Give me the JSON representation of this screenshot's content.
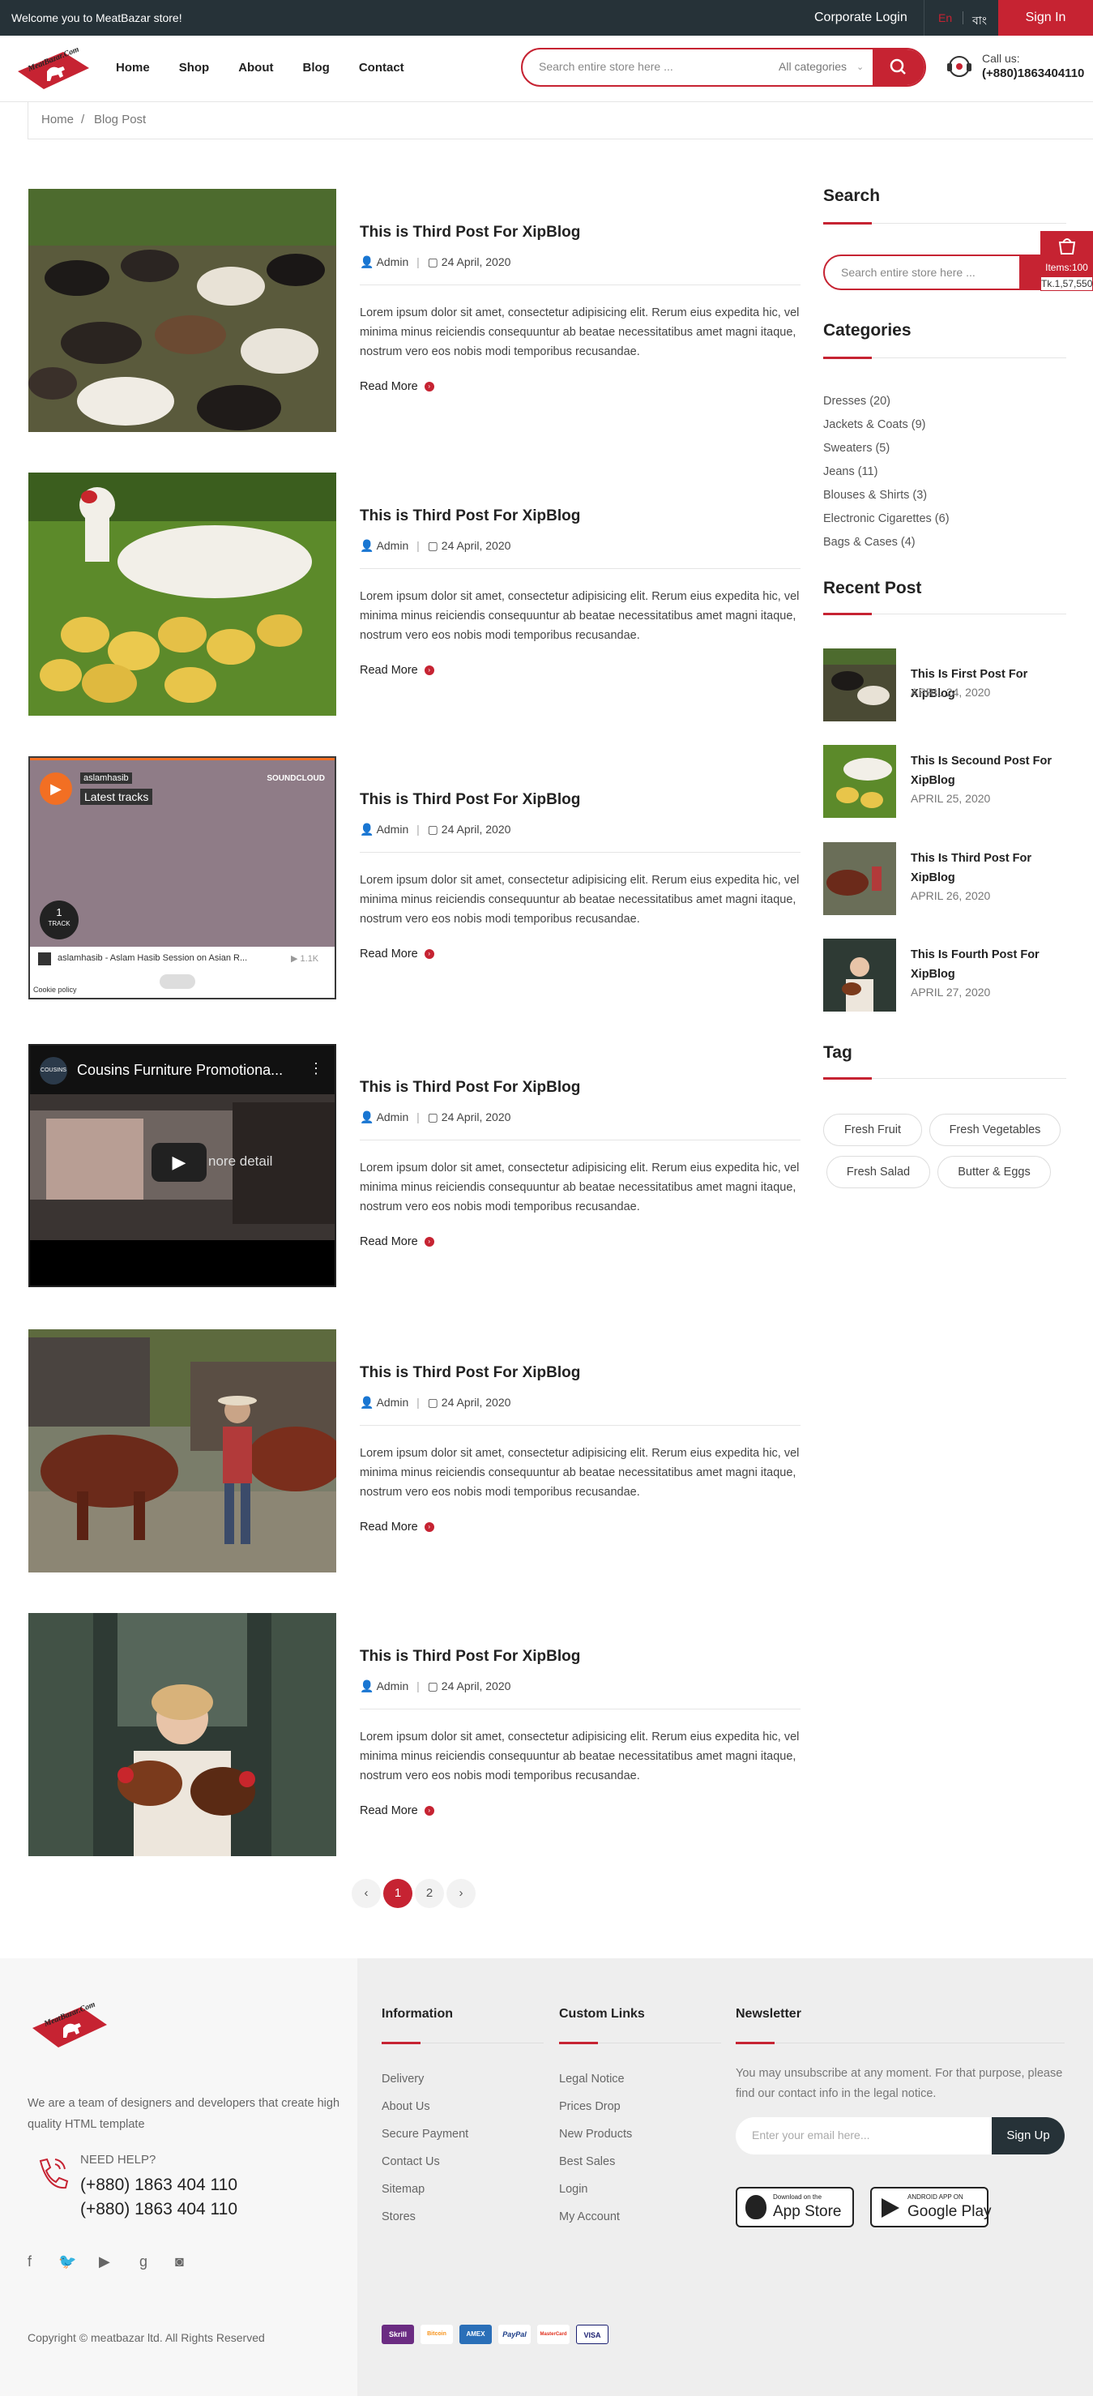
{
  "topbar": {
    "welcome": "Welcome you to MeatBazar store!",
    "corporate_login": "Corporate Login",
    "lang_en": "En",
    "lang_bn": "বাং",
    "sign_in": "Sign In"
  },
  "header": {
    "logo_text": "MeatBazar.Com",
    "nav": [
      "Home",
      "Shop",
      "About",
      "Blog",
      "Contact"
    ],
    "search_placeholder": "Search entire store here ...",
    "category_selected": "All categories",
    "call_label": "Call us:",
    "call_number": "(+880)1863404110"
  },
  "breadcrumb": {
    "home": "Home",
    "sep": "/",
    "current": "Blog Post"
  },
  "posts": [
    {
      "title": "This is Third Post For XipBlog",
      "author": "Admin",
      "date": "24 April, 2020",
      "excerpt": "Lorem ipsum dolor sit amet, consectetur adipisicing elit. Rerum eius expedita hic, vel minima minus reiciendis consequuntur ab beatae necessitatibus amet magni itaque, nostrum vero eos nobis modi temporibus recusandae.",
      "read_more": "Read More",
      "media": "goats-photo"
    },
    {
      "title": "This is Third Post For XipBlog",
      "author": "Admin",
      "date": "24 April, 2020",
      "excerpt": "Lorem ipsum dolor sit amet, consectetur adipisicing elit. Rerum eius expedita hic, vel minima minus reiciendis consequuntur ab beatae necessitatibus amet magni itaque, nostrum vero eos nobis modi temporibus recusandae.",
      "read_more": "Read More",
      "media": "ducks-photo"
    },
    {
      "title": "This is Third Post For XipBlog",
      "author": "Admin",
      "date": "24 April, 2020",
      "excerpt": "Lorem ipsum dolor sit amet, consectetur adipisicing elit. Rerum eius expedita hic, vel minima minus reiciendis consequuntur ab beatae necessitatibus amet magni itaque, nostrum vero eos nobis modi temporibus recusandae.",
      "read_more": "Read More",
      "media": "soundcloud-embed"
    },
    {
      "title": "This is Third Post For XipBlog",
      "author": "Admin",
      "date": "24 April, 2020",
      "excerpt": "Lorem ipsum dolor sit amet, consectetur adipisicing elit. Rerum eius expedita hic, vel minima minus reiciendis consequuntur ab beatae necessitatibus amet magni itaque, nostrum vero eos nobis modi temporibus recusandae.",
      "read_more": "Read More",
      "media": "youtube-embed"
    },
    {
      "title": "This is Third Post For XipBlog",
      "author": "Admin",
      "date": "24 April, 2020",
      "excerpt": "Lorem ipsum dolor sit amet, consectetur adipisicing elit. Rerum eius expedita hic, vel minima minus reiciendis consequuntur ab beatae necessitatibus amet magni itaque, nostrum vero eos nobis modi temporibus recusandae.",
      "read_more": "Read More",
      "media": "cattle-photo"
    },
    {
      "title": "This is Third Post For XipBlog",
      "author": "Admin",
      "date": "24 April, 2020",
      "excerpt": "Lorem ipsum dolor sit amet, consectetur adipisicing elit. Rerum eius expedita hic, vel minima minus reiciendis consequuntur ab beatae necessitatibus amet magni itaque, nostrum vero eos nobis modi temporibus recusandae.",
      "read_more": "Read More",
      "media": "chicken-girl-photo"
    }
  ],
  "soundcloud": {
    "user": "aslamhasib",
    "heading": "Latest tracks",
    "brand": "SOUNDCLOUD",
    "track_count": "1",
    "track_label": "TRACK",
    "track_title": "aslamhasib - Aslam Hasib Session on Asian R...",
    "plays": "1.1K",
    "cookie": "Cookie policy"
  },
  "youtube": {
    "channel": "COUSINS",
    "title": "Cousins Furniture Promotiona...",
    "overlay_text": "nore detail"
  },
  "pagination": {
    "prev": "‹",
    "pages": [
      "1",
      "2"
    ],
    "next": "›",
    "active": "1"
  },
  "sidebar": {
    "search_title": "Search",
    "search_placeholder": "Search entire store here ...",
    "categories_title": "Categories",
    "categories": [
      "Dresses (20)",
      "Jackets & Coats (9)",
      "Sweaters (5)",
      "Jeans (11)",
      "Blouses & Shirts (3)",
      "Electronic Cigarettes (6)",
      "Bags & Cases (4)"
    ],
    "recent_title": "Recent Post",
    "recent": [
      {
        "title": "This Is First Post For XipBlog",
        "date": "APRIL 24, 2020"
      },
      {
        "title": "This Is Secound Post For XipBlog",
        "date": "APRIL 25, 2020"
      },
      {
        "title": "This Is Third Post For XipBlog",
        "date": "APRIL 26, 2020"
      },
      {
        "title": "This Is Fourth Post For XipBlog",
        "date": "APRIL 27, 2020"
      }
    ],
    "tag_title": "Tag",
    "tags": [
      "Fresh Fruit",
      "Fresh Vegetables",
      "Fresh Salad",
      "Butter & Eggs"
    ]
  },
  "cart": {
    "items": "Items:100",
    "price": "Tk.1,57,550"
  },
  "footer": {
    "about": "We are a team of designers and developers that create high quality HTML template",
    "need_help": "NEED HELP?",
    "phone1": "(+880) 1863 404 110",
    "phone2": "(+880) 1863 404 110",
    "info_title": "Information",
    "info_links": [
      "Delivery",
      "About Us",
      "Secure Payment",
      "Contact Us",
      "Sitemap",
      "Stores"
    ],
    "custom_title": "Custom Links",
    "custom_links": [
      "Legal Notice",
      "Prices Drop",
      "New Products",
      "Best Sales",
      "Login",
      "My Account"
    ],
    "newsletter_title": "Newsletter",
    "newsletter_text": "You may unsubscribe at any moment. For that purpose, please find our contact info in the legal notice.",
    "email_placeholder": "Enter your email here...",
    "signup": "Sign Up",
    "appstore_small": "Download on the",
    "appstore_big": "App Store",
    "gplay_small": "ANDROID APP ON",
    "gplay_big": "Google Play",
    "copyright": "Copyright © meatbazar ltd. All Rights Reserved",
    "payments": [
      "Skrill",
      "Bitcoin",
      "AMEX",
      "PayPal",
      "MasterCard",
      "VISA"
    ]
  },
  "colors": {
    "accent": "#c62332",
    "dark": "#263238"
  }
}
